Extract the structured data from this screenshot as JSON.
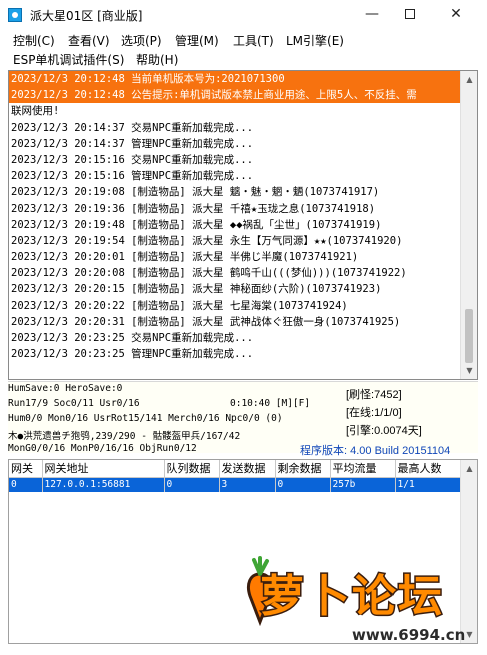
{
  "window": {
    "title": "派大星01区 [商业版]",
    "controls": {
      "minimize": "—",
      "maximize": "",
      "close": "✕"
    }
  },
  "menu": {
    "row1": [
      "控制(C)",
      "查看(V)",
      "选项(P)",
      "管理(M)",
      "工具(T)",
      "LM引擎(E)"
    ],
    "row2": [
      "ESP单机调试插件(S)",
      "帮助(H)"
    ]
  },
  "log": [
    {
      "text": "2023/12/3 20:12:48 当前单机版本号为:2021071300",
      "highlight": true
    },
    {
      "text": "2023/12/3 20:12:48 公告提示:单机调试版本禁止商业用途、上限5人、不反挂、需",
      "highlight": true
    },
    {
      "text": "联网使用!",
      "highlight": true,
      "wrap": true
    },
    {
      "text": "2023/12/3 20:14:37 交易NPC重新加载完成...",
      "highlight": false
    },
    {
      "text": "2023/12/3 20:14:37 管理NPC重新加载完成...",
      "highlight": false
    },
    {
      "text": "2023/12/3 20:15:16 交易NPC重新加载完成...",
      "highlight": false
    },
    {
      "text": "2023/12/3 20:15:16 管理NPC重新加载完成...",
      "highlight": false
    },
    {
      "text": "2023/12/3 20:19:08 [制造物品] 派大星 魑・魅・魍・魉(1073741917)",
      "highlight": false
    },
    {
      "text": "2023/12/3 20:19:36 [制造物品] 派大星 千禧★玉珑之息(1073741918)",
      "highlight": false
    },
    {
      "text": "2023/12/3 20:19:48 [制造物品] 派大星 ◆◆祸乱「尘世」(1073741919)",
      "highlight": false
    },
    {
      "text": "2023/12/3 20:19:54 [制造物品] 派大星 永生【万气同源】★★(1073741920)",
      "highlight": false
    },
    {
      "text": "2023/12/3 20:20:01 [制造物品] 派大星 半佛じ半魔(1073741921)",
      "highlight": false
    },
    {
      "text": "2023/12/3 20:20:08 [制造物品] 派大星 鹤鸣千山(((梦仙)))(1073741922)",
      "highlight": false
    },
    {
      "text": "2023/12/3 20:20:15 [制造物品] 派大星 神秘面纱(六阶)(1073741923)",
      "highlight": false
    },
    {
      "text": "2023/12/3 20:20:22 [制造物品] 派大星 七星海棠(1073741924)",
      "highlight": false
    },
    {
      "text": "2023/12/3 20:20:31 [制造物品] 派大星 武神战体ぐ狂傲一身(1073741925)",
      "highlight": false
    },
    {
      "text": "2023/12/3 20:23:25 交易NPC重新加载完成...",
      "highlight": false
    },
    {
      "text": "2023/12/3 20:23:25 管理NPC重新加载完成...",
      "highlight": false
    }
  ],
  "status": {
    "line1": "HumSave:0 HeroSave:0",
    "line2": "Run17/9 Soc0/11 Usr0/16",
    "line2_time": "0:10:40 [M][F]",
    "line3": "Hum0/0 Mon0/16 UsrRot15/141 Merch0/16 Npc0/0 (0)",
    "line4": "木●洪荒遗兽チ狍鸮,239/290 - 骷髅盔甲兵/167/42",
    "line5": "MonG0/0/16 MonP0/16/16 ObjRun0/12",
    "refresh": "[刷怪:7452]",
    "online": "[在线:1/1/0]",
    "engine": "[引擎:0.0074天]",
    "version": "程序版本: 4.00 Build 20151104"
  },
  "table": {
    "headers": [
      "网关",
      "网关地址",
      "队列数据",
      "发送数据",
      "剩余数据",
      "平均流量",
      "最高人数"
    ],
    "rows": [
      [
        "0",
        "127.0.0.1:56881",
        "0",
        "3",
        "0",
        "257b",
        "1/1"
      ]
    ]
  },
  "watermark": {
    "text": "萝卜论坛",
    "url": "www.6994.cn"
  },
  "colors": {
    "highlight": "#f7720f",
    "selection": "#0a64d8",
    "version_text": "#1046b8",
    "watermark": "#ff8a00"
  }
}
